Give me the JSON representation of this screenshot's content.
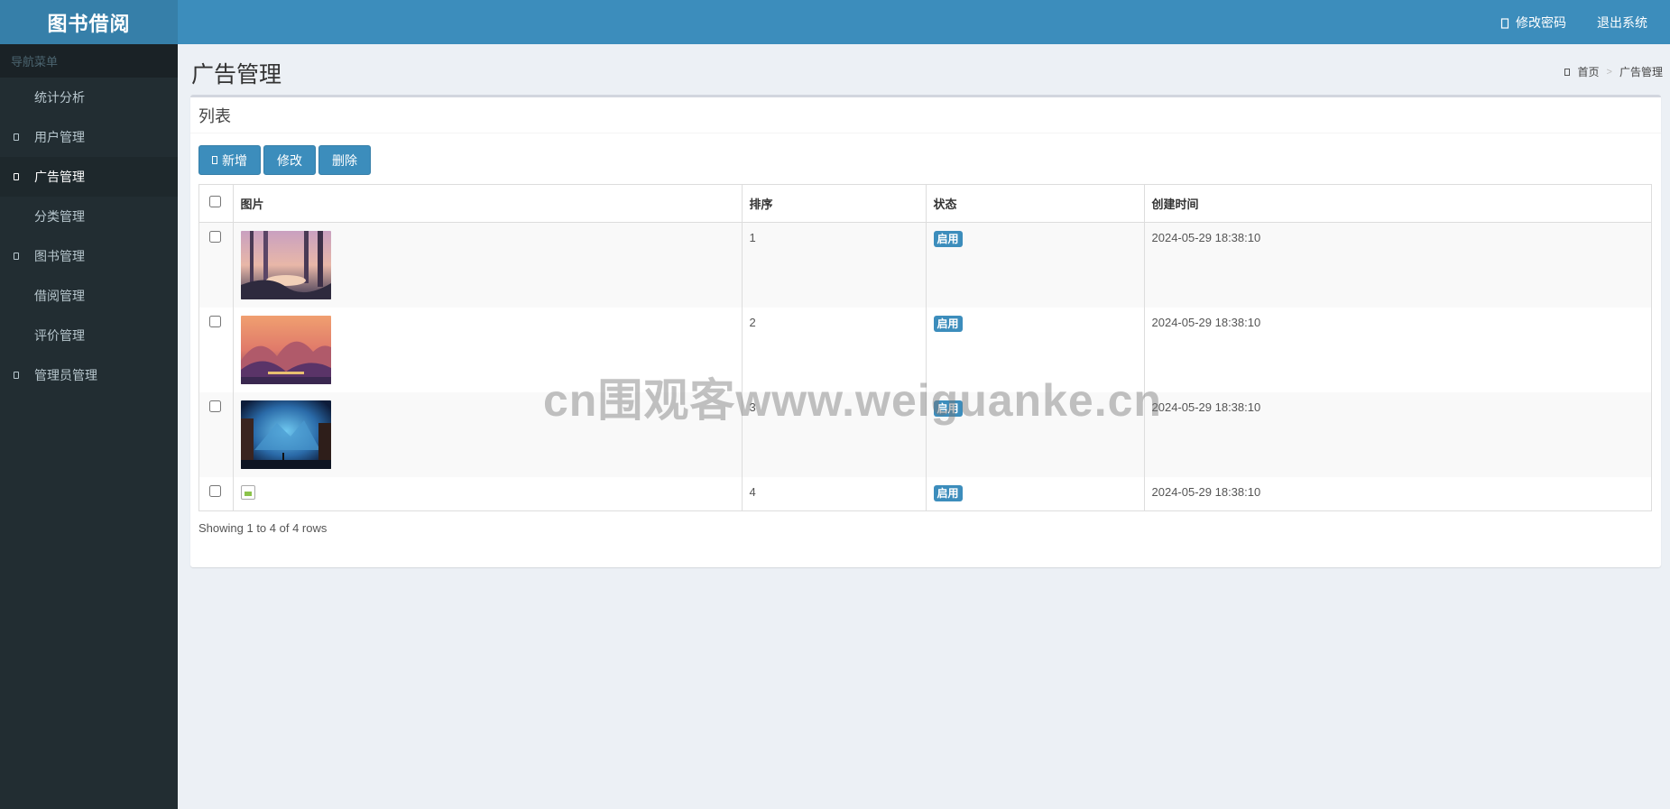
{
  "app": {
    "title": "图书借阅"
  },
  "header": {
    "change_password": "修改密码",
    "logout": "退出系统"
  },
  "sidebar": {
    "heading": "导航菜单",
    "items": [
      {
        "label": "统计分析",
        "has_icon": false,
        "active": false
      },
      {
        "label": "用户管理",
        "has_icon": true,
        "active": false
      },
      {
        "label": "广告管理",
        "has_icon": true,
        "active": true
      },
      {
        "label": "分类管理",
        "has_icon": false,
        "active": false
      },
      {
        "label": "图书管理",
        "has_icon": true,
        "active": false
      },
      {
        "label": "借阅管理",
        "has_icon": false,
        "active": false
      },
      {
        "label": "评价管理",
        "has_icon": false,
        "active": false
      },
      {
        "label": "管理员管理",
        "has_icon": true,
        "active": false
      }
    ]
  },
  "page": {
    "title": "广告管理",
    "breadcrumb": {
      "home": "首页",
      "current": "广告管理"
    }
  },
  "box": {
    "title": "列表",
    "toolbar": {
      "add": "新增",
      "edit": "修改",
      "delete": "删除"
    }
  },
  "table": {
    "columns": [
      "图片",
      "排序",
      "状态",
      "创建时间"
    ],
    "rows": [
      {
        "image": "forest-sunset-thumbnail",
        "sort": "1",
        "status": "启用",
        "created": "2024-05-29 18:38:10"
      },
      {
        "image": "mountain-sunset-thumbnail",
        "sort": "2",
        "status": "启用",
        "created": "2024-05-29 18:38:10"
      },
      {
        "image": "night-valley-thumbnail",
        "sort": "3",
        "status": "启用",
        "created": "2024-05-29 18:38:10"
      },
      {
        "image": "broken-image-icon",
        "sort": "4",
        "status": "启用",
        "created": "2024-05-29 18:38:10"
      }
    ],
    "pagination_info": "Showing 1 to 4 of 4 rows"
  },
  "watermark": "cn围观客www.weiguanke.cn",
  "colors": {
    "header": "#3c8dbc",
    "logo_bg": "#367fa9",
    "sidebar": "#222d32",
    "primary": "#3c8dbc"
  }
}
